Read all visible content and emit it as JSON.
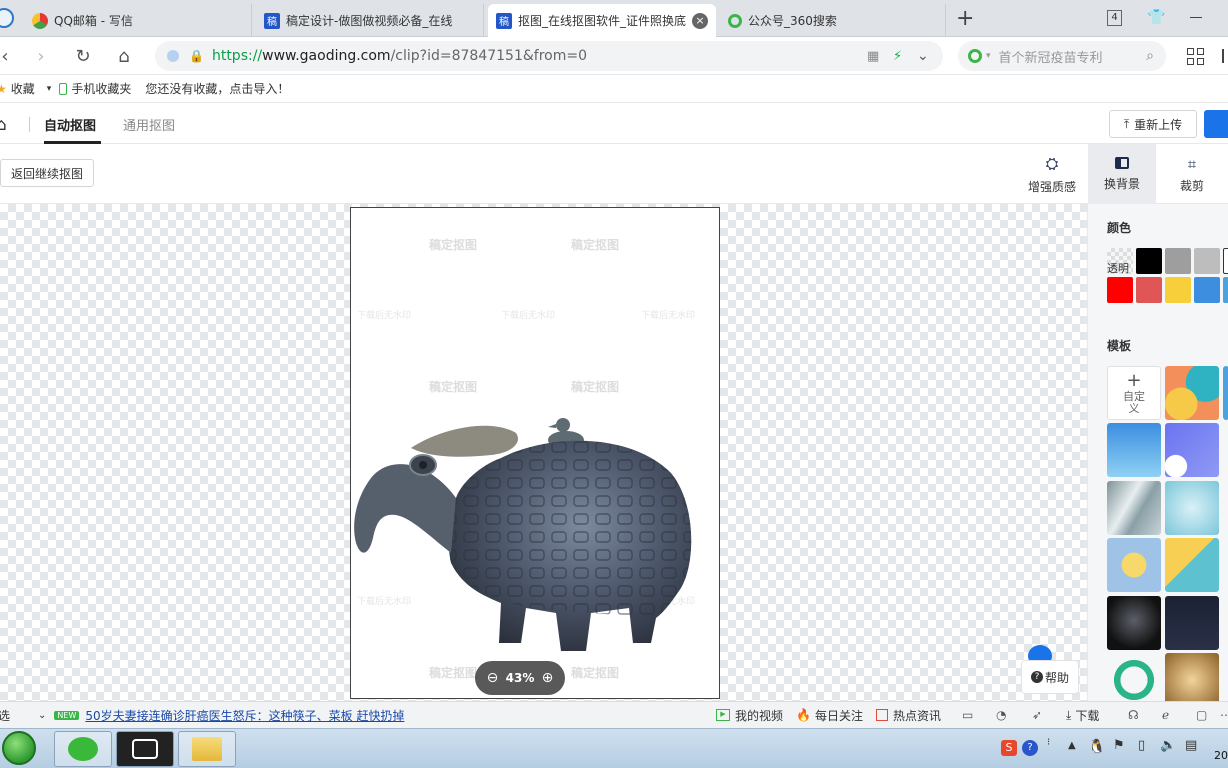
{
  "browser": {
    "tabs": [
      {
        "label": "QQ邮箱 - 写信",
        "icon": "qq-mail-icon"
      },
      {
        "label": "稿定设计-做图做视频必备_在线",
        "icon": "gaoding-icon"
      },
      {
        "label": "抠图_在线抠图软件_证件照换底",
        "icon": "gaoding-icon"
      },
      {
        "label": "公众号_360搜索",
        "icon": "360-search-icon"
      }
    ],
    "tab_count": "4",
    "url_scheme": "https://",
    "url_domain": "www.gaoding.com",
    "url_path": "/clip?id=87847151&from=0",
    "search_placeholder": "首个新冠疫苗专利",
    "favicon_letter": "稿"
  },
  "bookmarks": {
    "favorites": "收藏",
    "mobile": "手机收藏夹",
    "import_hint": "您还没有收藏，点击导入！"
  },
  "app": {
    "tabs": [
      "自动抠图",
      "通用抠图"
    ],
    "reupload": "重新上传",
    "back_button": "返回继续抠图",
    "tools": [
      "增强质感",
      "换背景",
      "裁剪"
    ],
    "zoom": "43%",
    "help": "帮助",
    "watermark": "稿定抠图",
    "watermark_small": "下载后无水印"
  },
  "panel": {
    "color_title": "颜色",
    "transparent": "透明",
    "colors_row1": [
      "#000000",
      "#9e9e9e",
      "#bdbdbd",
      "#ffffff"
    ],
    "colors_row2": [
      "#ff0000",
      "#e05555",
      "#f7cf3a",
      "#3d8ede",
      "#4aa3df"
    ],
    "template_title": "模板",
    "custom_label": "自定义"
  },
  "statusbar": {
    "left_label": "选",
    "news_badge": "NEW",
    "news": "50岁夫妻接连确诊肝癌医生怒斥：这种筷子、菜板 赶快扔掉",
    "my_video": "我的视频",
    "daily": "每日关注",
    "hot": "热点资讯",
    "download": "下载"
  },
  "taskbar": {
    "clock": "20"
  },
  "colors": {
    "accent": "#1a73e8",
    "url_green": "#0a9e46"
  }
}
